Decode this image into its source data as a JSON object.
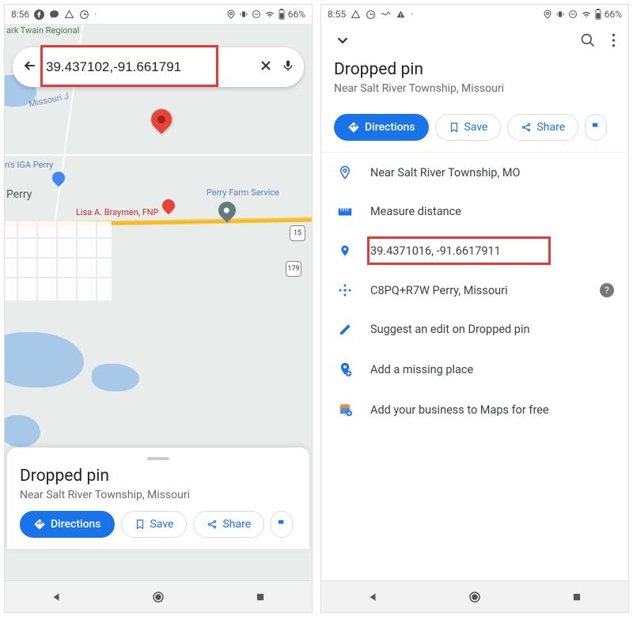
{
  "left": {
    "status": {
      "time": "8:56",
      "battery": "66%"
    },
    "search": {
      "value": "39.437102,-91.661791"
    },
    "town": "Perry",
    "park": "ark Twain Regional",
    "river": "Missouri J",
    "poi": {
      "iga": "n's IGA Perry",
      "farm": "Perry Farm Service",
      "lisa": "Lisa A. Braymen, FNP"
    },
    "shields": {
      "s1": "15",
      "s2": "179"
    },
    "card": {
      "title": "Dropped pin",
      "sub": "Near Salt River Township, Missouri",
      "directions": "Directions",
      "save": "Save",
      "share": "Share"
    }
  },
  "right": {
    "status": {
      "time": "8:55",
      "battery": "66%"
    },
    "card": {
      "title": "Dropped pin",
      "sub": "Near Salt River Township, Missouri",
      "directions": "Directions",
      "save": "Save",
      "share": "Share"
    },
    "rows": {
      "near": "Near Salt River Township, MO",
      "measure": "Measure distance",
      "coords": "39.4371016, -91.6617911",
      "plus": "C8PQ+R7W Perry, Missouri",
      "suggest": "Suggest an edit on Dropped pin",
      "missing": "Add a missing place",
      "business": "Add your business to Maps for free"
    }
  }
}
